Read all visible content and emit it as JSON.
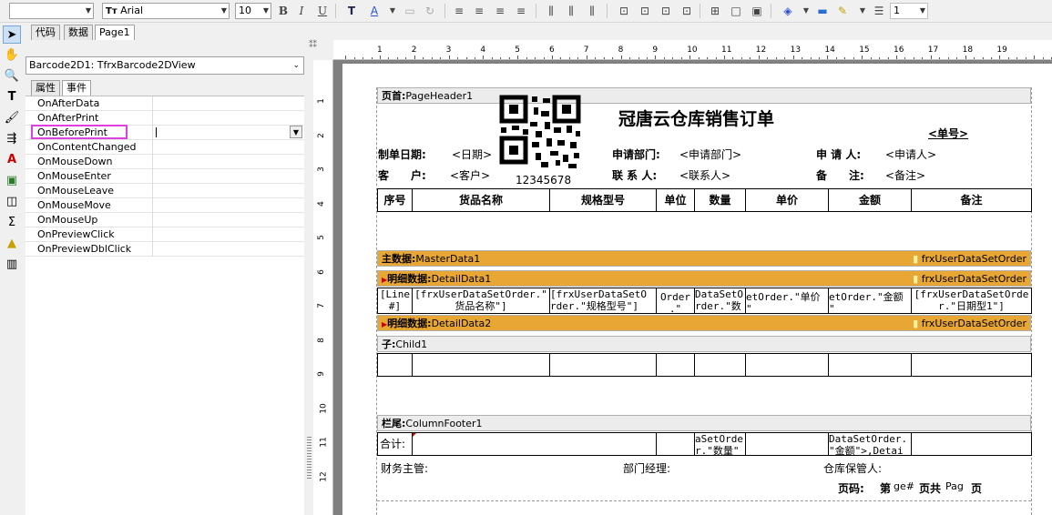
{
  "toolbar": {
    "style_value": "",
    "font_name": "Arial",
    "font_size": "10",
    "bold_label": "B",
    "italic_label": "I",
    "underline_label": "U",
    "line_width": "1"
  },
  "tabs": [
    {
      "label": "代码"
    },
    {
      "label": "数据"
    },
    {
      "label": "Page1"
    }
  ],
  "inspector": {
    "component": "Barcode2D1: TfrxBarcode2DView",
    "tab_properties": "属性",
    "tab_events": "事件",
    "events": [
      "OnAfterData",
      "OnAfterPrint",
      "OnBeforePrint",
      "OnContentChanged",
      "OnMouseDown",
      "OnMouseEnter",
      "OnMouseLeave",
      "OnMouseMove",
      "OnMouseUp",
      "OnPreviewClick",
      "OnPreviewDblClick"
    ],
    "selected_event": "OnBeforePrint"
  },
  "ruler": {
    "h_ticks": [
      "1",
      "2",
      "3",
      "4",
      "5",
      "6",
      "7",
      "8",
      "9",
      "10",
      "11",
      "12",
      "13",
      "14",
      "15",
      "16",
      "17",
      "18",
      "19"
    ],
    "v_ticks": [
      "1",
      "2",
      "3",
      "4",
      "5",
      "6",
      "7",
      "8",
      "9",
      "10",
      "11",
      "12"
    ]
  },
  "report": {
    "page_header_band": "页首:",
    "page_header_name": "PageHeader1",
    "title": "冠唐云仓库销售订单",
    "barcode_text": "12345678",
    "order_no": "<单号>",
    "date_label": "制单日期:",
    "date_value": "<日期>",
    "customer_label": "客　　户:",
    "customer_value": "<客户>",
    "dept_label": "申请部门:",
    "dept_value": "<申请部门>",
    "contact_label": "联 系 人:",
    "contact_value": "<联系人>",
    "applicant_label": "申 请 人:",
    "applicant_value": "<申请人>",
    "remark_label": "备　　注:",
    "remark_value": "<备注>",
    "columns": [
      "序号",
      "货品名称",
      "规格型号",
      "单位",
      "数量",
      "单价",
      "金额",
      "备注"
    ],
    "master_band": "主数据:",
    "master_name": "MasterData1",
    "dataset": "frxUserDataSetOrder",
    "detail1_band": "明细数据:",
    "detail1_name": "DetailData1",
    "detail_cells": [
      "[Line\n#]",
      "[frxUserDataSetOrder.\"\n货品名称\"]",
      "[frxUserDataSetO\nrder.\"规格型号\"]",
      "Order\n.\"",
      "DataSetO\nrder.\"数",
      "etOrder.\"单价\n\"",
      "etOrder.\"金额\n\"",
      "[frxUserDataSetOrde\nr.\"日期型1\"]"
    ],
    "detail2_band": "明细数据:",
    "detail2_name": "DetailData2",
    "child_band": "子:",
    "child_name": "Child1",
    "footer_band": "栏尾:",
    "footer_name": "ColumnFooter1",
    "total_label": "合计:",
    "total_qty": "aSetOrde\nr.\"数量\"",
    "total_amount": "DataSetOrder.\n\"金额\">,Detai",
    "finance_label": "财务主管:",
    "manager_label": "部门经理:",
    "keeper_label": "仓库保管人:",
    "page_label": "页码:",
    "page_parts": [
      "第",
      "ge#",
      "页共",
      "Pag",
      "页"
    ]
  }
}
